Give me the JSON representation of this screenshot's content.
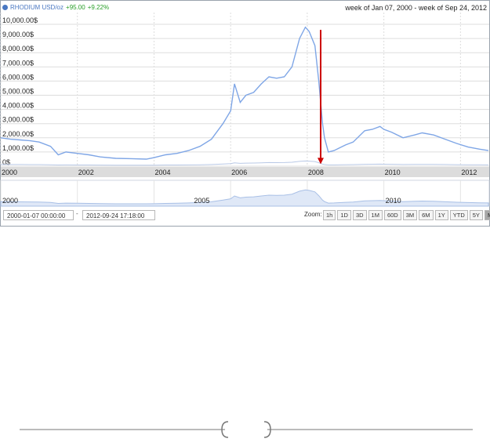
{
  "header": {
    "series_label": "RHODIUM USD/oz",
    "change_abs": "+95.00",
    "change_pct": "+9.22%",
    "range_text": "week of Jan 07, 2000 - week of Sep 24, 2012"
  },
  "controls": {
    "start_time": "2000-01-07 00:00:00",
    "separator": "-",
    "end_time": "2012-09-24 17:18:00",
    "zoom_label": "Zoom:",
    "zoom_buttons": [
      "1h",
      "1D",
      "3D",
      "1M",
      "60D",
      "3M",
      "6M",
      "1Y",
      "YTD",
      "5Y",
      "MAX"
    ],
    "active_zoom": "MAX"
  },
  "colors": {
    "line": "#7fa6e6",
    "navigator_fill": "#dfe8f7",
    "arrow": "#cc0000",
    "axis_band": "#dcdcdc"
  },
  "chart_data": {
    "type": "line",
    "series": [
      {
        "x": [
          2000.0,
          2000.25,
          2000.5,
          2000.75,
          2001.0,
          2001.3,
          2001.5,
          2001.7,
          2002.0,
          2002.3,
          2002.6,
          2003.0,
          2003.4,
          2003.8,
          2004.0,
          2004.3,
          2004.6,
          2004.9,
          2005.2,
          2005.5,
          2005.8,
          2006.0,
          2006.1,
          2006.25,
          2006.4,
          2006.6,
          2006.8,
          2007.0,
          2007.2,
          2007.4,
          2007.6,
          2007.8,
          2007.95,
          2008.05,
          2008.2,
          2008.3,
          2008.4,
          2008.45,
          2008.55,
          2008.7,
          2008.85,
          2009.0,
          2009.2,
          2009.5,
          2009.7,
          2009.9,
          2010.0,
          2010.2,
          2010.5,
          2010.8,
          2011.0,
          2011.3,
          2011.6,
          2011.9,
          2012.2,
          2012.5,
          2012.73
        ],
        "values": [
          2000,
          1900,
          1850,
          1800,
          1700,
          1400,
          800,
          1000,
          900,
          800,
          650,
          550,
          530,
          500,
          600,
          800,
          900,
          1100,
          1400,
          1900,
          3000,
          3900,
          5800,
          4500,
          5000,
          5200,
          5800,
          6300,
          6200,
          6300,
          7000,
          9000,
          9800,
          9500,
          8500,
          6000,
          3000,
          2000,
          1000,
          1100,
          1300,
          1500,
          1700,
          2500,
          2600,
          2800,
          2600,
          2400,
          2000,
          2200,
          2350,
          2200,
          1900,
          1600,
          1350,
          1200,
          1100
        ]
      }
    ],
    "ylim": [
      0,
      10500
    ],
    "xlim": [
      2000,
      2012.75
    ],
    "y_ticks": [
      "0$",
      "1,000.00$",
      "2,000.00$",
      "3,000.00$",
      "4,000.00$",
      "5,000.00$",
      "6,000.00$",
      "7,000.00$",
      "8,000.00$",
      "9,000.00$",
      "10,000.00$"
    ],
    "y_tick_values": [
      0,
      1000,
      2000,
      3000,
      4000,
      5000,
      6000,
      7000,
      8000,
      9000,
      10000
    ],
    "x_ticks": [
      "2000",
      "2002",
      "2004",
      "2006",
      "2008",
      "2010",
      "2012"
    ],
    "x_tick_values": [
      2000,
      2002,
      2004,
      2006,
      2008,
      2010,
      2012
    ],
    "navigator_labels": [
      "2000",
      "2005",
      "2010"
    ],
    "navigator_label_values": [
      2000,
      2005,
      2010
    ],
    "grid": true,
    "annotation": {
      "type": "arrow",
      "x": 2008.35,
      "from_value": 9500,
      "to_value": 200
    }
  }
}
